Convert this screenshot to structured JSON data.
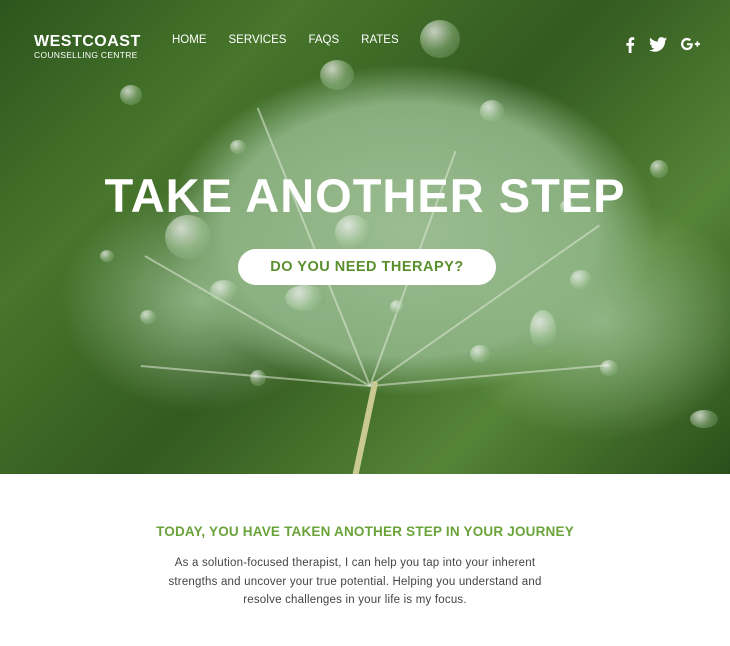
{
  "brand": {
    "name": "WESTCOAST",
    "subtitle": "COUNSELLING CENTRE"
  },
  "nav": [
    {
      "label": "HOME"
    },
    {
      "label": "SERVICES"
    },
    {
      "label": "FAQS"
    },
    {
      "label": "RATES"
    }
  ],
  "social": [
    {
      "icon": "facebook-icon"
    },
    {
      "icon": "twitter-icon"
    },
    {
      "icon": "google-plus-icon"
    }
  ],
  "hero": {
    "title": "TAKE ANOTHER STEP",
    "cta_label": "DO YOU NEED THERAPY?"
  },
  "intro": {
    "heading": "TODAY, YOU HAVE TAKEN ANOTHER STEP IN YOUR JOURNEY",
    "line1": "As a solution-focused therapist, I can help you tap into your inherent",
    "line2": "strengths and uncover your true potential. Helping you understand and",
    "line3": "resolve challenges in your life is my focus."
  },
  "colors": {
    "accent": "#6aa33a",
    "cta_text": "#5a8f2e",
    "body_text": "#444444"
  }
}
